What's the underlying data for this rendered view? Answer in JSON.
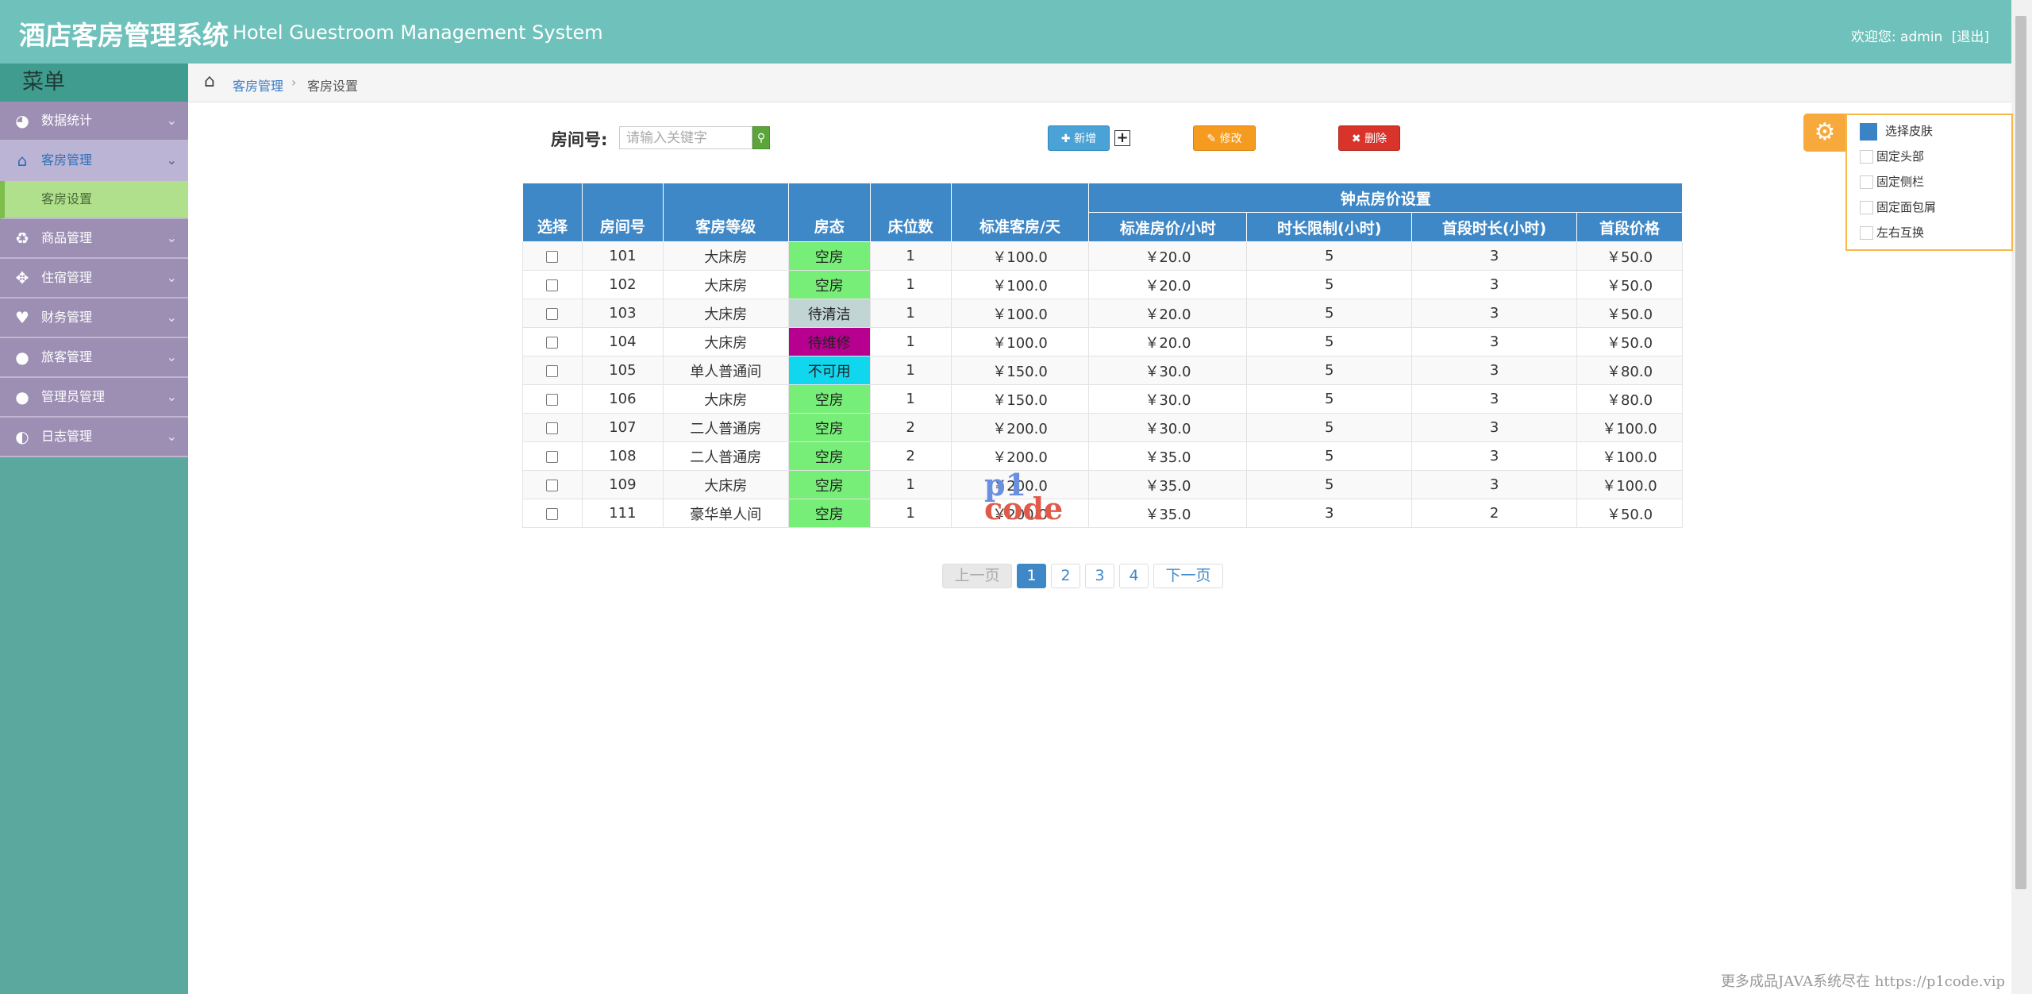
{
  "header": {
    "title_cn": "酒店客房管理系统",
    "title_en": "Hotel Guestroom Management System",
    "welcome": "欢迎您: admin",
    "logout": "[退出]"
  },
  "sidebar": {
    "menu_title": "菜单",
    "items": [
      {
        "label": "数据统计",
        "icon": "dashboard-icon"
      },
      {
        "label": "客房管理",
        "icon": "home-icon",
        "active": true
      },
      {
        "label": "客房设置",
        "sub": true
      },
      {
        "label": "商品管理",
        "icon": "cup-icon"
      },
      {
        "label": "住宿管理",
        "icon": "move-icon"
      },
      {
        "label": "财务管理",
        "icon": "heart-icon"
      },
      {
        "label": "旅客管理",
        "icon": "user-icon"
      },
      {
        "label": "管理员管理",
        "icon": "user-icon"
      },
      {
        "label": "日志管理",
        "icon": "contrast-icon"
      }
    ]
  },
  "breadcrumb": {
    "parent": "客房管理",
    "current": "客房设置"
  },
  "toolbar": {
    "room_label": "房间号:",
    "search_placeholder": "请输入关键字",
    "add_label": "新增",
    "edit_label": "修改",
    "delete_label": "删除"
  },
  "settings": {
    "skin": "选择皮肤",
    "fix_header": "固定头部",
    "fix_sidebar": "固定侧栏",
    "fix_breadcrumb": "固定面包屑",
    "swap": "左右互换",
    "skin_color": "#3a83c4"
  },
  "table": {
    "headers": {
      "select": "选择",
      "room_no": "房间号",
      "grade": "客房等级",
      "status": "房态",
      "beds": "床位数",
      "std_price": "标准客房/天",
      "group": "钟点房价设置",
      "hour_price": "标准房价/小时",
      "time_limit": "时长限制(小时)",
      "first_duration": "首段时长(小时)",
      "first_price": "首段价格"
    },
    "rows": [
      {
        "room": "101",
        "grade": "大床房",
        "status": "空房",
        "status_color": "#77ee77",
        "beds": "1",
        "std": "￥100.0",
        "hour": "￥20.0",
        "limit": "5",
        "first_dur": "3",
        "first_price": "￥50.0"
      },
      {
        "room": "102",
        "grade": "大床房",
        "status": "空房",
        "status_color": "#77ee77",
        "beds": "1",
        "std": "￥100.0",
        "hour": "￥20.0",
        "limit": "5",
        "first_dur": "3",
        "first_price": "￥50.0"
      },
      {
        "room": "103",
        "grade": "大床房",
        "status": "待清洁",
        "status_color": "#c2d5d5",
        "beds": "1",
        "std": "￥100.0",
        "hour": "￥20.0",
        "limit": "5",
        "first_dur": "3",
        "first_price": "￥50.0"
      },
      {
        "room": "104",
        "grade": "大床房",
        "status": "待维修",
        "status_color": "#b7008f",
        "beds": "1",
        "std": "￥100.0",
        "hour": "￥20.0",
        "limit": "5",
        "first_dur": "3",
        "first_price": "￥50.0"
      },
      {
        "room": "105",
        "grade": "单人普通间",
        "status": "不可用",
        "status_color": "#11d7ee",
        "beds": "1",
        "std": "￥150.0",
        "hour": "￥30.0",
        "limit": "5",
        "first_dur": "3",
        "first_price": "￥80.0"
      },
      {
        "room": "106",
        "grade": "大床房",
        "status": "空房",
        "status_color": "#77ee77",
        "beds": "1",
        "std": "￥150.0",
        "hour": "￥30.0",
        "limit": "5",
        "first_dur": "3",
        "first_price": "￥80.0"
      },
      {
        "room": "107",
        "grade": "二人普通房",
        "status": "空房",
        "status_color": "#77ee77",
        "beds": "2",
        "std": "￥200.0",
        "hour": "￥30.0",
        "limit": "5",
        "first_dur": "3",
        "first_price": "￥100.0"
      },
      {
        "room": "108",
        "grade": "二人普通房",
        "status": "空房",
        "status_color": "#77ee77",
        "beds": "2",
        "std": "￥200.0",
        "hour": "￥35.0",
        "limit": "5",
        "first_dur": "3",
        "first_price": "￥100.0"
      },
      {
        "room": "109",
        "grade": "大床房",
        "status": "空房",
        "status_color": "#77ee77",
        "beds": "1",
        "std": "￥200.0",
        "hour": "￥35.0",
        "limit": "5",
        "first_dur": "3",
        "first_price": "￥100.0"
      },
      {
        "room": "111",
        "grade": "豪华单人间",
        "status": "空房",
        "status_color": "#77ee77",
        "beds": "1",
        "std": "￥200.0",
        "hour": "￥35.0",
        "limit": "3",
        "first_dur": "2",
        "first_price": "￥50.0"
      }
    ]
  },
  "pagination": {
    "prev": "上一页",
    "pages": [
      "1",
      "2",
      "3",
      "4"
    ],
    "current": "1",
    "next": "下一页"
  },
  "watermark": {
    "logo_top": "p1",
    "logo_bottom": "code",
    "footer": "更多成品JAVA系统尽在 https://p1code.vip"
  }
}
